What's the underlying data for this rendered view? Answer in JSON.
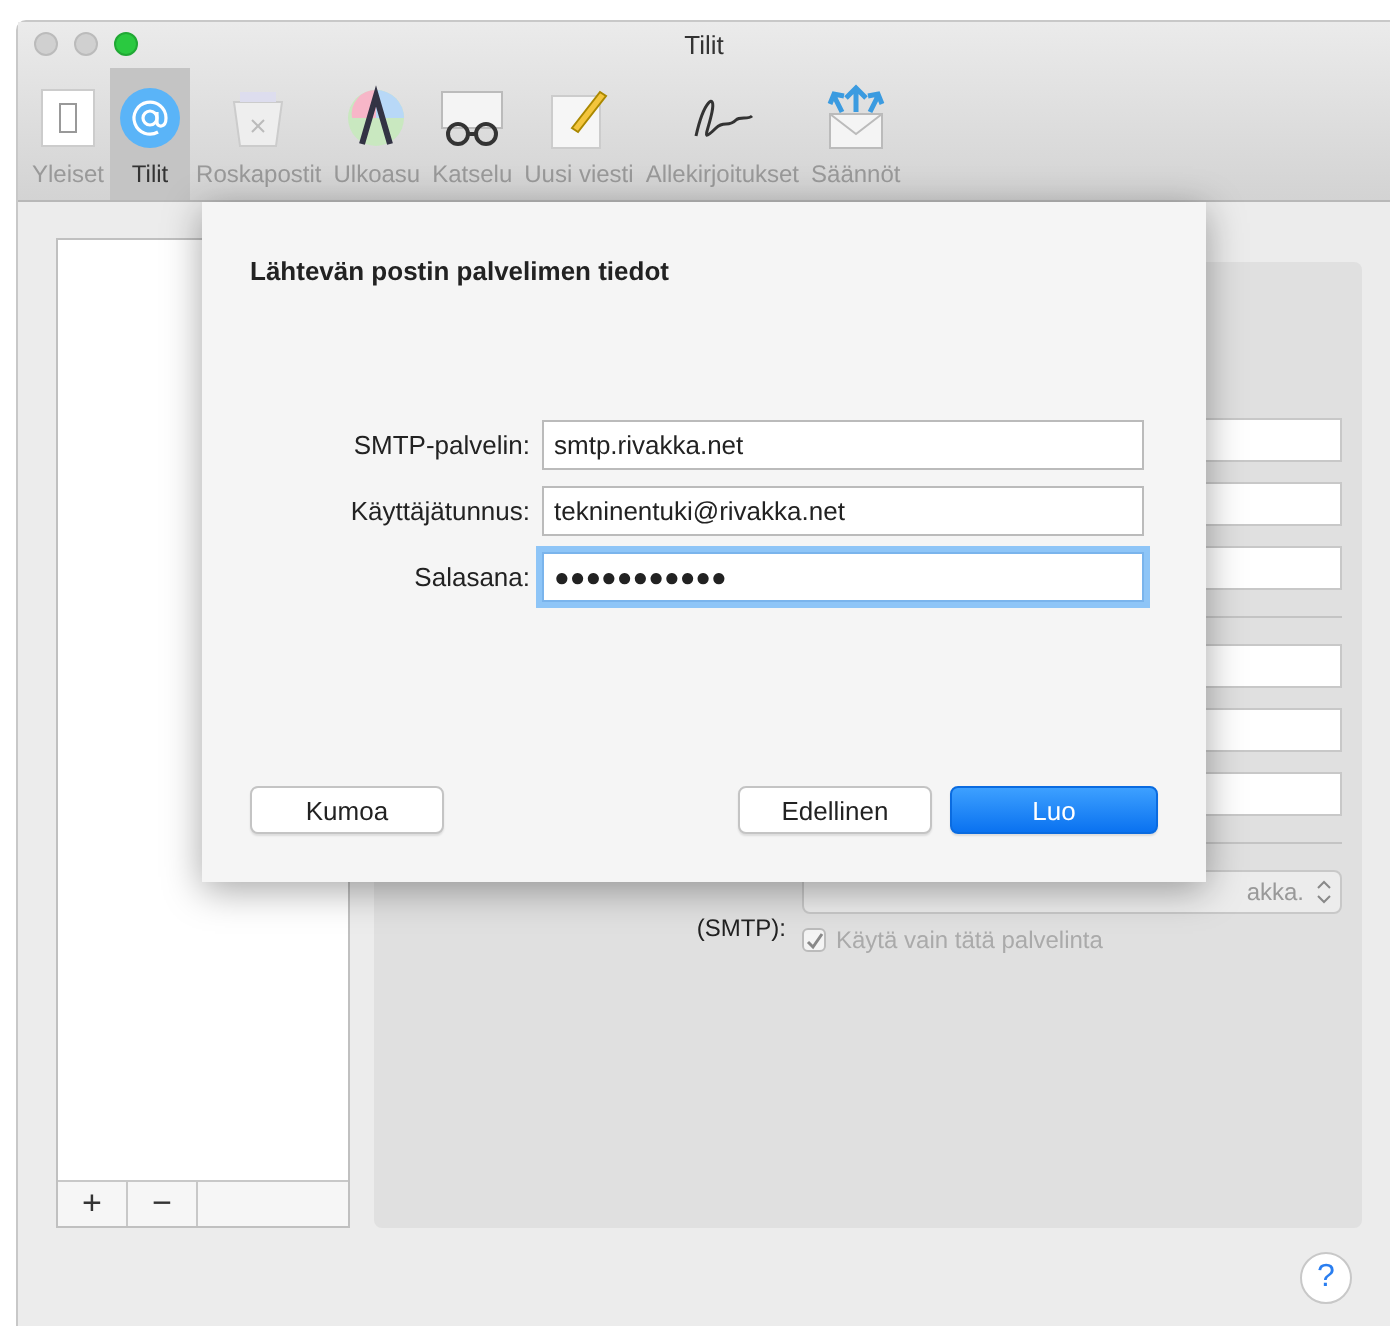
{
  "window": {
    "title": "Tilit"
  },
  "toolbar": [
    {
      "label": "Yleiset",
      "selected": false
    },
    {
      "label": "Tilit",
      "selected": true
    },
    {
      "label": "Roskapostit",
      "selected": false
    },
    {
      "label": "Ulkoasu",
      "selected": false
    },
    {
      "label": "Katselu",
      "selected": false
    },
    {
      "label": "Uusi viesti",
      "selected": false
    },
    {
      "label": "Allekirjoitukset",
      "selected": false
    },
    {
      "label": "Säännöt",
      "selected": false
    }
  ],
  "account_list": {
    "add": "+",
    "remove": "−"
  },
  "settings": {
    "smtp_popup": "akka.",
    "smtp_label": "(SMTP):",
    "only_this_server": {
      "label": "Käytä vain tätä palvelinta",
      "checked": true,
      "disabled": true
    }
  },
  "sheet": {
    "title": "Lähtevän postin palvelimen tiedot",
    "fields": [
      {
        "label": "SMTP-palvelin:",
        "value": "smtp.rivakka.net",
        "focused": false
      },
      {
        "label": "Käyttäjätunnus:",
        "value": "tekninentuki@rivakka.net",
        "focused": false
      },
      {
        "label": "Salasana:",
        "value": "●●●●●●●●●●●",
        "focused": true
      }
    ],
    "buttons": [
      {
        "label": "Kumoa",
        "kind": "cancel"
      },
      {
        "label": "Edellinen",
        "kind": "normal"
      },
      {
        "label": "Luo",
        "kind": "default"
      }
    ]
  },
  "help": "?"
}
